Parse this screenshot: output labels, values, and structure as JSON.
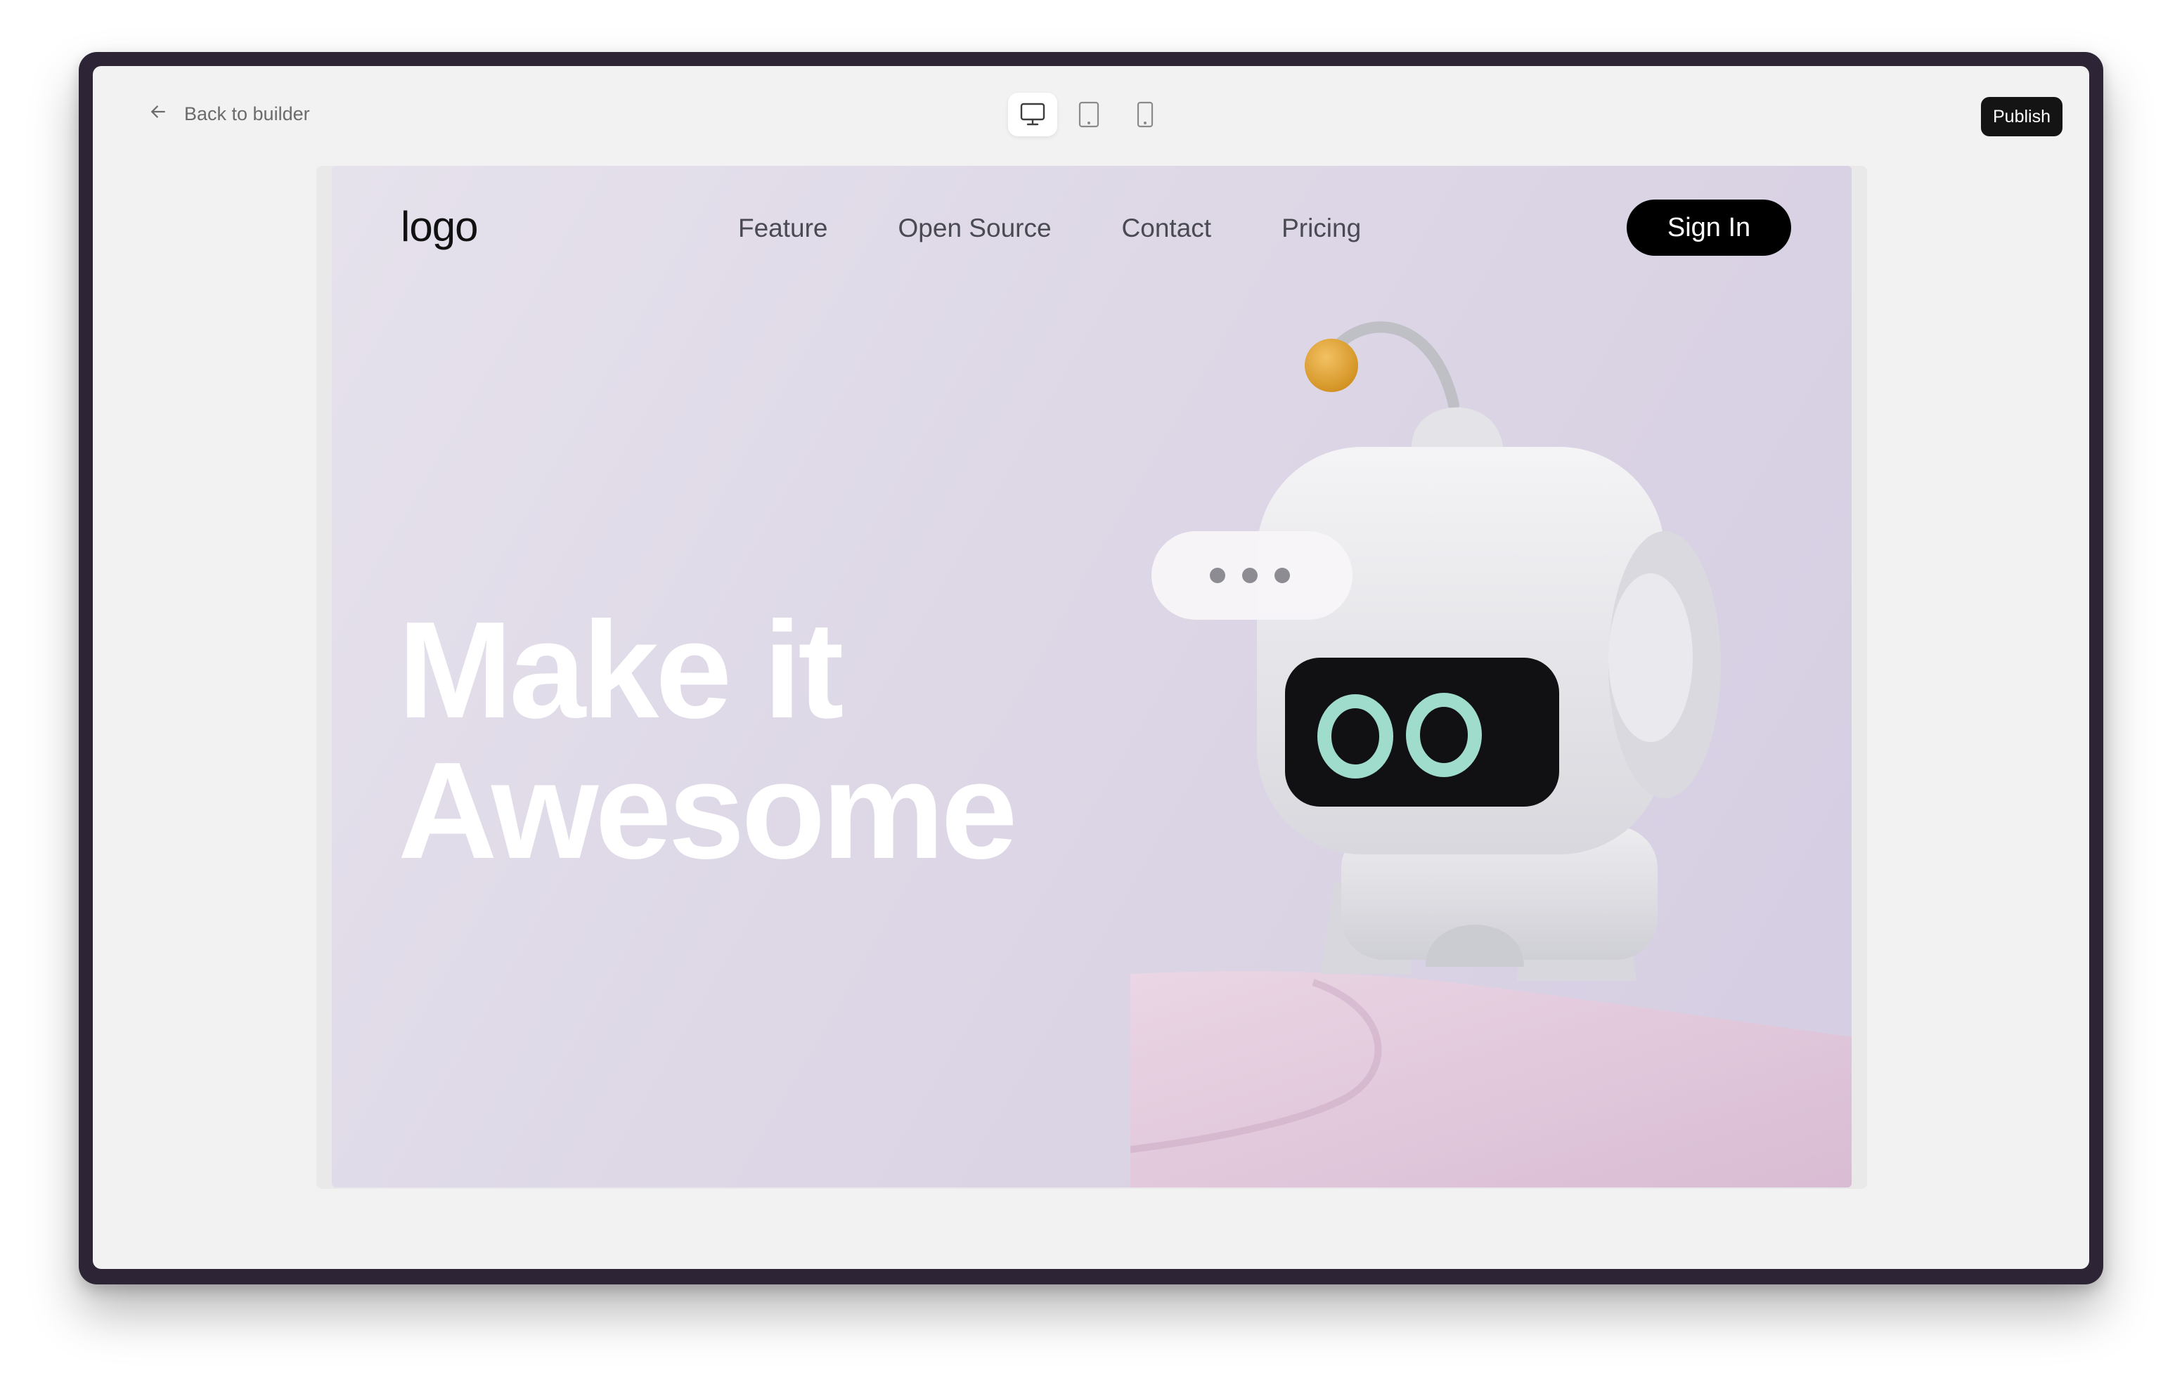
{
  "toolbar": {
    "back_label": "Back to builder",
    "devices": [
      {
        "icon": "desktop-icon",
        "active": true
      },
      {
        "icon": "tablet-icon",
        "active": false
      },
      {
        "icon": "mobile-icon",
        "active": false
      }
    ],
    "publish_label": "Publish"
  },
  "site": {
    "logo": "logo",
    "nav": [
      "Feature",
      "Open Source",
      "Contact",
      "Pricing"
    ],
    "sign_in_label": "Sign In",
    "headline_line1": "Make it",
    "headline_line2": "Awesome",
    "illustration": "robot-with-speech-bubble"
  },
  "colors": {
    "frame": "#2d2535",
    "screen_bg": "#f2f2f2",
    "hero_bg": "#ddd7e6",
    "publish_bg": "#141414",
    "sign_in_bg": "#000000",
    "robot_eyes": "#9fdccc",
    "antenna_ball": "#e0a431",
    "pedestal": "#e2c8dc"
  }
}
